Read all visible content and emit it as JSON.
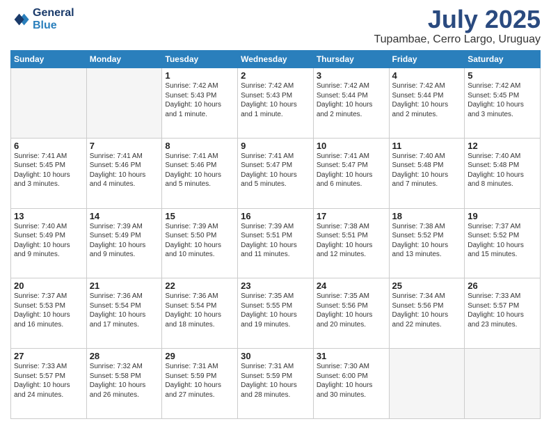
{
  "header": {
    "logo_line1": "General",
    "logo_line2": "Blue",
    "month": "July 2025",
    "location": "Tupambae, Cerro Largo, Uruguay"
  },
  "weekdays": [
    "Sunday",
    "Monday",
    "Tuesday",
    "Wednesday",
    "Thursday",
    "Friday",
    "Saturday"
  ],
  "weeks": [
    [
      {
        "day": "",
        "info": ""
      },
      {
        "day": "",
        "info": ""
      },
      {
        "day": "1",
        "info": "Sunrise: 7:42 AM\nSunset: 5:43 PM\nDaylight: 10 hours and 1 minute."
      },
      {
        "day": "2",
        "info": "Sunrise: 7:42 AM\nSunset: 5:43 PM\nDaylight: 10 hours and 1 minute."
      },
      {
        "day": "3",
        "info": "Sunrise: 7:42 AM\nSunset: 5:44 PM\nDaylight: 10 hours and 2 minutes."
      },
      {
        "day": "4",
        "info": "Sunrise: 7:42 AM\nSunset: 5:44 PM\nDaylight: 10 hours and 2 minutes."
      },
      {
        "day": "5",
        "info": "Sunrise: 7:42 AM\nSunset: 5:45 PM\nDaylight: 10 hours and 3 minutes."
      }
    ],
    [
      {
        "day": "6",
        "info": "Sunrise: 7:41 AM\nSunset: 5:45 PM\nDaylight: 10 hours and 3 minutes."
      },
      {
        "day": "7",
        "info": "Sunrise: 7:41 AM\nSunset: 5:46 PM\nDaylight: 10 hours and 4 minutes."
      },
      {
        "day": "8",
        "info": "Sunrise: 7:41 AM\nSunset: 5:46 PM\nDaylight: 10 hours and 5 minutes."
      },
      {
        "day": "9",
        "info": "Sunrise: 7:41 AM\nSunset: 5:47 PM\nDaylight: 10 hours and 5 minutes."
      },
      {
        "day": "10",
        "info": "Sunrise: 7:41 AM\nSunset: 5:47 PM\nDaylight: 10 hours and 6 minutes."
      },
      {
        "day": "11",
        "info": "Sunrise: 7:40 AM\nSunset: 5:48 PM\nDaylight: 10 hours and 7 minutes."
      },
      {
        "day": "12",
        "info": "Sunrise: 7:40 AM\nSunset: 5:48 PM\nDaylight: 10 hours and 8 minutes."
      }
    ],
    [
      {
        "day": "13",
        "info": "Sunrise: 7:40 AM\nSunset: 5:49 PM\nDaylight: 10 hours and 9 minutes."
      },
      {
        "day": "14",
        "info": "Sunrise: 7:39 AM\nSunset: 5:49 PM\nDaylight: 10 hours and 9 minutes."
      },
      {
        "day": "15",
        "info": "Sunrise: 7:39 AM\nSunset: 5:50 PM\nDaylight: 10 hours and 10 minutes."
      },
      {
        "day": "16",
        "info": "Sunrise: 7:39 AM\nSunset: 5:51 PM\nDaylight: 10 hours and 11 minutes."
      },
      {
        "day": "17",
        "info": "Sunrise: 7:38 AM\nSunset: 5:51 PM\nDaylight: 10 hours and 12 minutes."
      },
      {
        "day": "18",
        "info": "Sunrise: 7:38 AM\nSunset: 5:52 PM\nDaylight: 10 hours and 13 minutes."
      },
      {
        "day": "19",
        "info": "Sunrise: 7:37 AM\nSunset: 5:52 PM\nDaylight: 10 hours and 15 minutes."
      }
    ],
    [
      {
        "day": "20",
        "info": "Sunrise: 7:37 AM\nSunset: 5:53 PM\nDaylight: 10 hours and 16 minutes."
      },
      {
        "day": "21",
        "info": "Sunrise: 7:36 AM\nSunset: 5:54 PM\nDaylight: 10 hours and 17 minutes."
      },
      {
        "day": "22",
        "info": "Sunrise: 7:36 AM\nSunset: 5:54 PM\nDaylight: 10 hours and 18 minutes."
      },
      {
        "day": "23",
        "info": "Sunrise: 7:35 AM\nSunset: 5:55 PM\nDaylight: 10 hours and 19 minutes."
      },
      {
        "day": "24",
        "info": "Sunrise: 7:35 AM\nSunset: 5:56 PM\nDaylight: 10 hours and 20 minutes."
      },
      {
        "day": "25",
        "info": "Sunrise: 7:34 AM\nSunset: 5:56 PM\nDaylight: 10 hours and 22 minutes."
      },
      {
        "day": "26",
        "info": "Sunrise: 7:33 AM\nSunset: 5:57 PM\nDaylight: 10 hours and 23 minutes."
      }
    ],
    [
      {
        "day": "27",
        "info": "Sunrise: 7:33 AM\nSunset: 5:57 PM\nDaylight: 10 hours and 24 minutes."
      },
      {
        "day": "28",
        "info": "Sunrise: 7:32 AM\nSunset: 5:58 PM\nDaylight: 10 hours and 26 minutes."
      },
      {
        "day": "29",
        "info": "Sunrise: 7:31 AM\nSunset: 5:59 PM\nDaylight: 10 hours and 27 minutes."
      },
      {
        "day": "30",
        "info": "Sunrise: 7:31 AM\nSunset: 5:59 PM\nDaylight: 10 hours and 28 minutes."
      },
      {
        "day": "31",
        "info": "Sunrise: 7:30 AM\nSunset: 6:00 PM\nDaylight: 10 hours and 30 minutes."
      },
      {
        "day": "",
        "info": ""
      },
      {
        "day": "",
        "info": ""
      }
    ]
  ]
}
